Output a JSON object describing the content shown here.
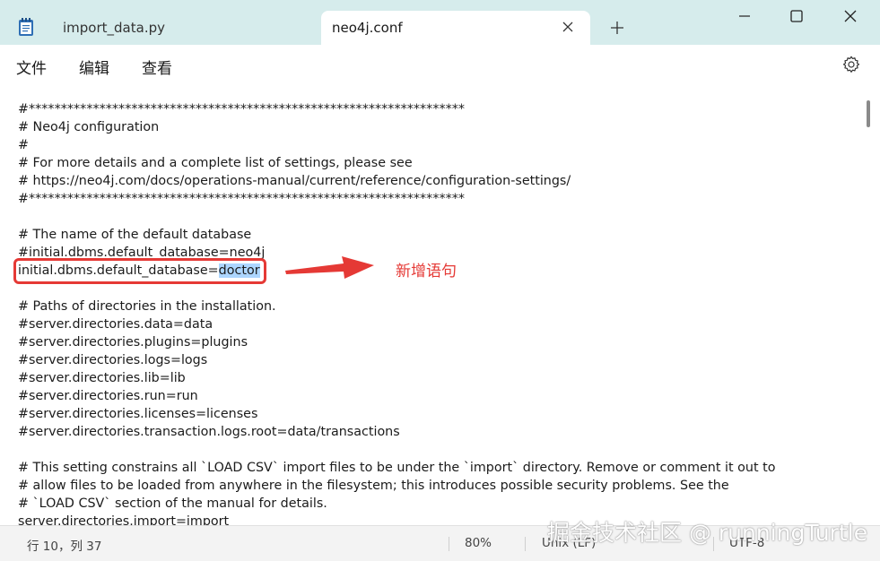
{
  "tabs": [
    {
      "label": "import_data.py",
      "active": false
    },
    {
      "label": "neo4j.conf",
      "active": true
    }
  ],
  "menu": [
    "文件",
    "编辑",
    "查看"
  ],
  "editor": {
    "lines": [
      "#********************************************************************",
      "# Neo4j configuration",
      "#",
      "# For more details and a complete list of settings, please see",
      "# https://neo4j.com/docs/operations-manual/current/reference/configuration-settings/",
      "#********************************************************************",
      "",
      "# The name of the default database",
      "#initial.dbms.default_database=neo4j",
      "initial.dbms.default_database=",
      "",
      "# Paths of directories in the installation.",
      "#server.directories.data=data",
      "#server.directories.plugins=plugins",
      "#server.directories.logs=logs",
      "#server.directories.lib=lib",
      "#server.directories.run=run",
      "#server.directories.licenses=licenses",
      "#server.directories.transaction.logs.root=data/transactions",
      "",
      "# This setting constrains all `LOAD CSV` import files to be under the `import` directory. Remove or comment it out to",
      "# allow files to be loaded from anywhere in the filesystem; this introduces possible security problems. See the",
      "# `LOAD CSV` section of the manual for details.",
      "server.directories.import=import"
    ],
    "selected_text": "doctor"
  },
  "annotation": {
    "text": "新增语句",
    "color": "#e53935"
  },
  "status": {
    "position": "行 10，列 37",
    "zoom": "80%",
    "line_ending": "Unix (LF)",
    "encoding": "UTF-8"
  },
  "watermark": "掘金技术社区 @ runningTurtle",
  "colors": {
    "accent_bg": "#d6ecec",
    "selection": "#add6ff",
    "annotation": "#e53935"
  }
}
